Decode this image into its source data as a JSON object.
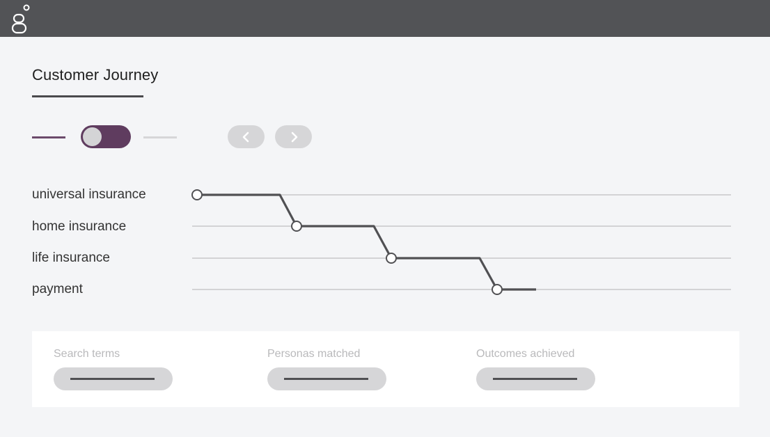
{
  "header": {
    "logo_icon": "genesys-logo-icon",
    "bg_color": "#525356"
  },
  "journey": {
    "title": "Customer Journey",
    "accent_color": "#5f3c5f",
    "stages": [
      {
        "label": "universal insurance"
      },
      {
        "label": "home insurance"
      },
      {
        "label": "life insurance"
      },
      {
        "label": "payment"
      }
    ],
    "controls": {
      "toggle_state": "on",
      "prev_icon": "chevron-left-icon",
      "next_icon": "chevron-right-icon"
    }
  },
  "metrics": [
    {
      "label": "Search terms"
    },
    {
      "label": "Personas matched"
    },
    {
      "label": "Outcomes achieved"
    }
  ]
}
